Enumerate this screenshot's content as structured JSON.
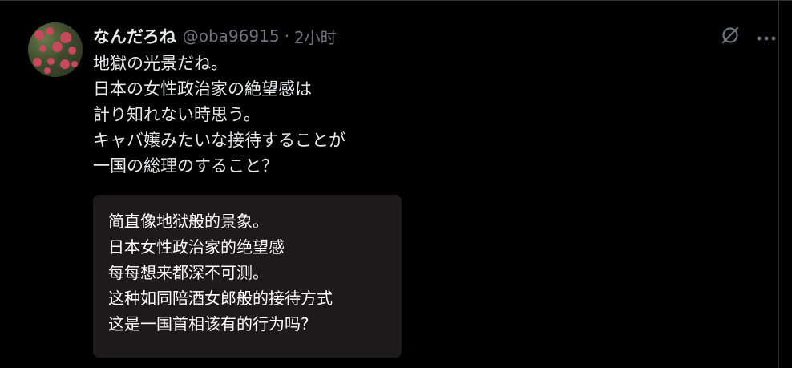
{
  "tweet": {
    "display_name": "なんだろね",
    "handle": "@oba96915",
    "separator": "·",
    "time": "2小时",
    "text_lines": [
      "地獄の光景だね。",
      "日本の女性政治家の絶望感は",
      "計り知れない時思う。",
      "キャバ嬢みたいな接待することが",
      "一国の総理のすること？"
    ],
    "media_text_lines": [
      "简直像地狱般的景象。",
      "日本女性政治家的绝望感",
      "每每想来都深不可测。",
      "这种如同陪酒女郎般的接待方式",
      "这是一国首相该有的行为吗?"
    ],
    "icons": {
      "grok": "grok-slash-icon",
      "more": "more-dots-icon"
    }
  },
  "colors": {
    "background": "#000000",
    "primary_text": "#e7e9ea",
    "secondary_text": "#71767b",
    "border": "#2f3336",
    "media_background": "#1c1a1a"
  }
}
